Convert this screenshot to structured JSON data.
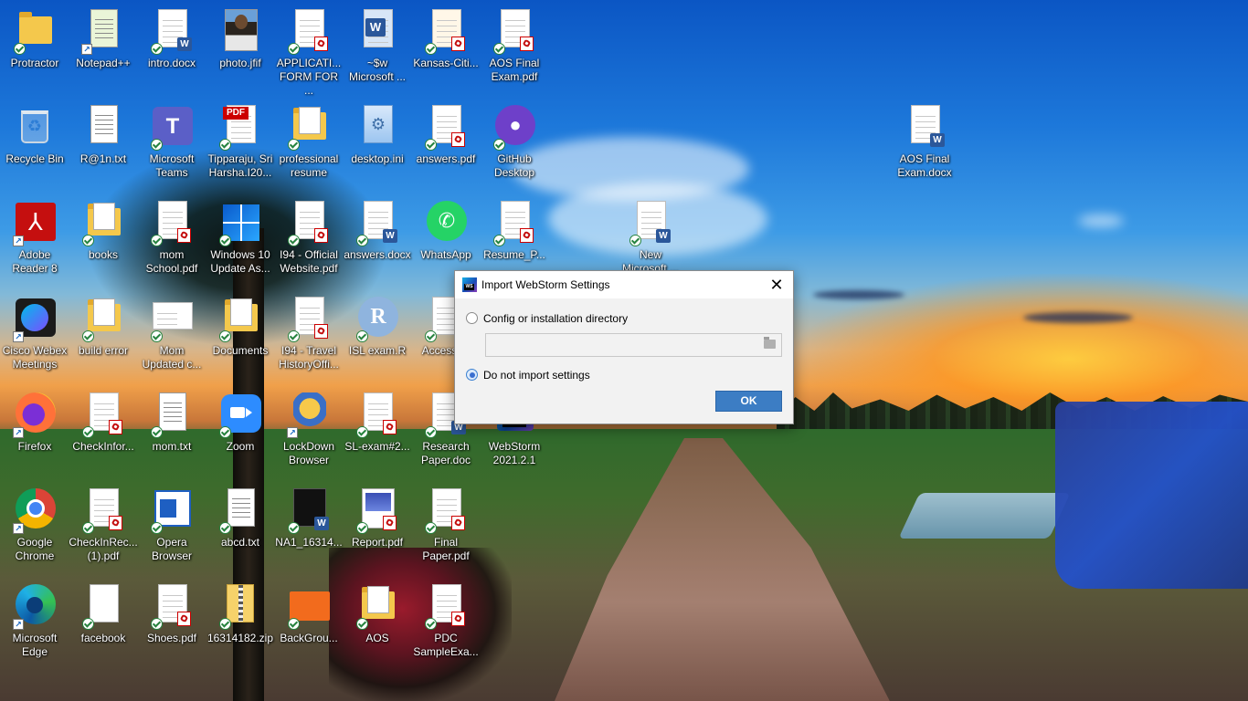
{
  "desktop": {
    "icons": [
      {
        "label": "Protractor"
      },
      {
        "label": "Notepad++"
      },
      {
        "label": "intro.docx"
      },
      {
        "label": "photo.jfif"
      },
      {
        "label": "APPLICATI...\nFORM FOR ..."
      },
      {
        "label": "~$w\nMicrosoft ..."
      },
      {
        "label": "Kansas-Citi..."
      },
      {
        "label": "AOS Final\nExam.pdf"
      },
      {
        "label": "Recycle Bin"
      },
      {
        "label": "R@1n.txt"
      },
      {
        "label": "Microsoft\nTeams"
      },
      {
        "label": "Tipparaju, Sri\nHarsha.I20..."
      },
      {
        "label": "professional\nresume"
      },
      {
        "label": "desktop.ini"
      },
      {
        "label": "answers.pdf"
      },
      {
        "label": "GitHub\nDesktop"
      },
      {
        "label": "AOS Final\nExam.docx"
      },
      {
        "label": "Adobe\nReader 8"
      },
      {
        "label": "books"
      },
      {
        "label": "mom\nSchool.pdf"
      },
      {
        "label": "Windows 10\nUpdate As..."
      },
      {
        "label": "I94 - Official\nWebsite.pdf"
      },
      {
        "label": "answers.docx"
      },
      {
        "label": "WhatsApp"
      },
      {
        "label": "Resume_P..."
      },
      {
        "label": "New\nMicrosoft ..."
      },
      {
        "label": "Cisco Webex\nMeetings"
      },
      {
        "label": "build error"
      },
      {
        "label": "Mom\nUpdated c..."
      },
      {
        "label": "Documents"
      },
      {
        "label": "I94 - Travel\nHistoryOffi..."
      },
      {
        "label": "ISL exam.R"
      },
      {
        "label": "Access-..."
      },
      {
        "label": "Firefox"
      },
      {
        "label": "CheckInfor..."
      },
      {
        "label": "mom.txt"
      },
      {
        "label": "Zoom"
      },
      {
        "label": "LockDown\nBrowser"
      },
      {
        "label": "SL-exam#2..."
      },
      {
        "label": "Research\nPaper.doc"
      },
      {
        "label": "WebStorm\n2021.2.1"
      },
      {
        "label": "Google\nChrome"
      },
      {
        "label": "CheckInRec...\n(1).pdf"
      },
      {
        "label": "Opera\nBrowser"
      },
      {
        "label": "abcd.txt"
      },
      {
        "label": "NA1_16314..."
      },
      {
        "label": "Report.pdf"
      },
      {
        "label": "Final\nPaper.pdf"
      },
      {
        "label": "Microsoft\nEdge"
      },
      {
        "label": "facebook"
      },
      {
        "label": "Shoes.pdf"
      },
      {
        "label": "16314182.zip"
      },
      {
        "label": "BackGrou..."
      },
      {
        "label": "AOS"
      },
      {
        "label": "PDC\nSampleExa..."
      }
    ]
  },
  "dialog": {
    "title": "Import WebStorm Settings",
    "option_config_label": "Config or installation directory",
    "option_config_selected": false,
    "path_value": "",
    "option_no_import_label": "Do not import settings",
    "option_no_import_selected": true,
    "ok_label": "OK"
  },
  "colors": {
    "ok_button": "#3c7dc4",
    "dialog_bg": "#f2f2f2"
  }
}
